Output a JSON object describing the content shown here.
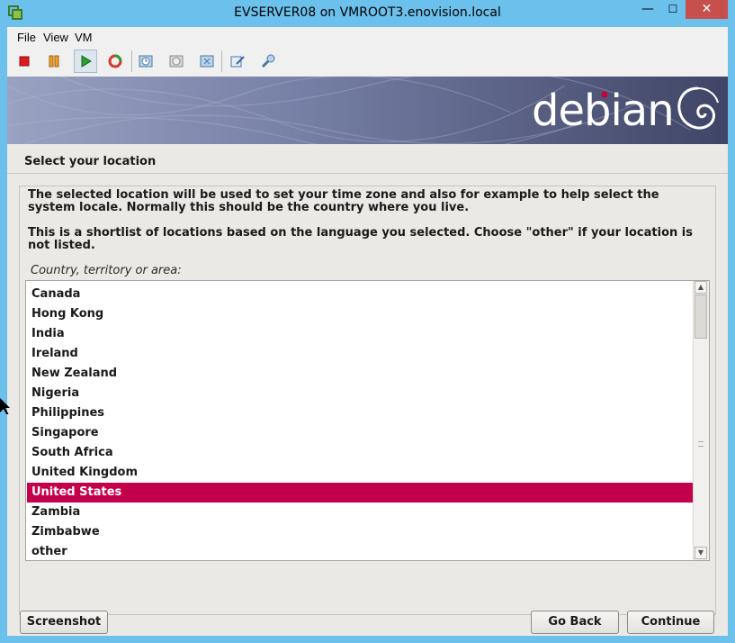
{
  "window": {
    "title": "EVSERVER08 on VMROOT3.enovision.local",
    "minimize_glyph": "—",
    "maximize_glyph": "☐",
    "close_glyph": "✕"
  },
  "menu": {
    "file": "File",
    "view": "View",
    "vm": "VM"
  },
  "toolbar": {
    "icons": [
      "stop-icon",
      "pause-icon",
      "play-icon",
      "reset-icon",
      "snapshot-icon",
      "revert-snapshot-icon",
      "manage-snapshots-icon",
      "edit-settings-icon",
      "tools-icon"
    ],
    "colors": {
      "stop": "#e0191f",
      "pause": "#f0a020",
      "play": "#2aa032",
      "reset": "#d43a2a"
    }
  },
  "installer": {
    "brand": "debian",
    "brand_color": "#c70036",
    "step_title": "Select your location",
    "paragraph1": "The selected location will be used to set your time zone and also for example to help select the system locale. Normally this should be the country where you live.",
    "paragraph2": "This is a shortlist of locations based on the language you selected. Choose \"other\" if your location is not listed.",
    "field_label": "Country, territory or area:",
    "locations": [
      "Canada",
      "Hong Kong",
      "India",
      "Ireland",
      "New Zealand",
      "Nigeria",
      "Philippines",
      "Singapore",
      "South Africa",
      "United Kingdom",
      "United States",
      "Zambia",
      "Zimbabwe",
      "other"
    ],
    "selected": "United States",
    "buttons": {
      "screenshot": "Screenshot",
      "go_back": "Go Back",
      "continue": "Continue"
    }
  }
}
